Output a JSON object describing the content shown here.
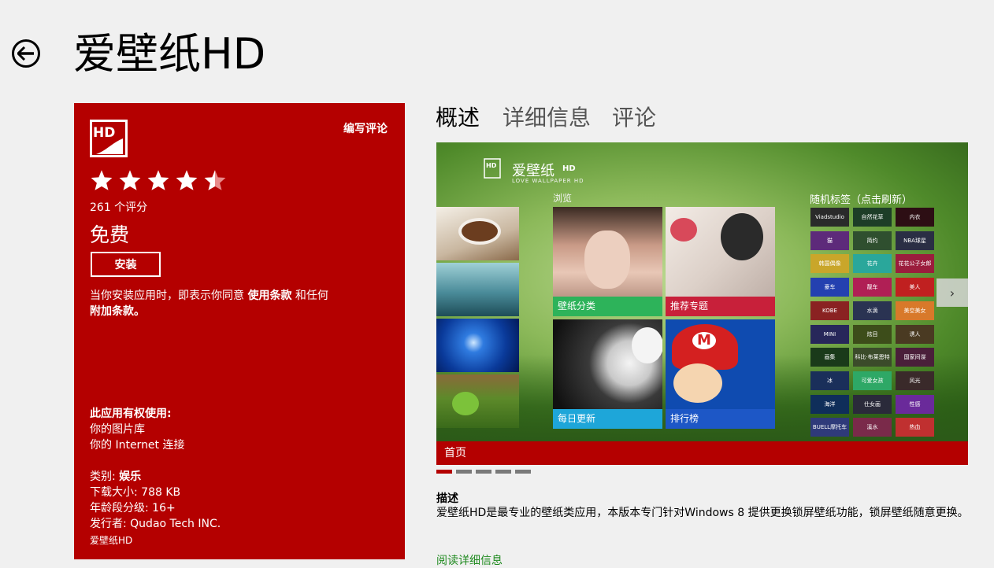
{
  "header": {
    "title": "爱壁纸HD",
    "back_icon": "back-arrow-icon"
  },
  "panel": {
    "background": "#b40000",
    "logo_text": "HD",
    "write_review": "编写评论",
    "rating": {
      "value": 4.5,
      "max": 5,
      "count_label": "261 个评分"
    },
    "price": "免费",
    "install_label": "安装",
    "terms": {
      "prefix": "当你安装应用时，即表示你同意",
      "terms_link": "使用条款",
      "middle": "和任何",
      "additional_link": "附加条款",
      "suffix": "。"
    },
    "permissions": {
      "title": "此应用有权使用:",
      "items": [
        "你的图片库",
        "你的 Internet 连接"
      ]
    },
    "meta": {
      "category_label": "类别:",
      "category_value": "娱乐",
      "size": "下载大小: 788 KB",
      "age": "年龄段分级: 16+",
      "publisher": "发行者: Qudao Tech INC.",
      "app_name": "爱壁纸HD"
    }
  },
  "tabs": [
    {
      "label": "概述",
      "active": true
    },
    {
      "label": "详细信息",
      "active": false
    },
    {
      "label": "评论",
      "active": false
    }
  ],
  "screenshot": {
    "logo_text": "爱壁纸",
    "logo_hd": "HD",
    "logo_sub": "LOVE WALLPAPER HD",
    "browse_label": "浏览",
    "tags_title": "随机标签（点击刷新）",
    "tiles": [
      {
        "label": "壁纸分类",
        "color": "#2db35a"
      },
      {
        "label": "推荐专题",
        "color": "#c8203a"
      },
      {
        "label": "每日更新",
        "color": "#1ea6d9"
      },
      {
        "label": "排行榜",
        "color": "#1d57c6"
      }
    ],
    "tags": [
      {
        "label": "Viadstudio",
        "color": "#2a2a2a"
      },
      {
        "label": "自然花草",
        "color": "#1d3d27"
      },
      {
        "label": "内衣",
        "color": "#2d0e14"
      },
      {
        "label": "猫",
        "color": "#5d2a7a"
      },
      {
        "label": "简约",
        "color": "#2f4f2f"
      },
      {
        "label": "NBA球星",
        "color": "#2a2e44"
      },
      {
        "label": "韩国偶像",
        "color": "#c9a62a"
      },
      {
        "label": "花卉",
        "color": "#2aa79b"
      },
      {
        "label": "花花公子女郎",
        "color": "#9b1d3d"
      },
      {
        "label": "豪车",
        "color": "#2440b0"
      },
      {
        "label": "靓车",
        "color": "#b01f55"
      },
      {
        "label": "美人",
        "color": "#c02020"
      },
      {
        "label": "KOBE",
        "color": "#8a2222"
      },
      {
        "label": "水滴",
        "color": "#2a3352"
      },
      {
        "label": "美空美女",
        "color": "#d8792a"
      },
      {
        "label": "MINI",
        "color": "#27275a"
      },
      {
        "label": "炫目",
        "color": "#3d4d1a"
      },
      {
        "label": "诱人",
        "color": "#4a3a22"
      },
      {
        "label": "画集",
        "color": "#1a3a1a"
      },
      {
        "label": "科比·布莱恩特",
        "color": "#3b4b2a"
      },
      {
        "label": "国家间谍",
        "color": "#4a1f3a"
      },
      {
        "label": "冰",
        "color": "#1a2f5a"
      },
      {
        "label": "可爱女孩",
        "color": "#2ea866"
      },
      {
        "label": "风光",
        "color": "#3a2a2a"
      },
      {
        "label": "海洋",
        "color": "#0f2e5a"
      },
      {
        "label": "仕女画",
        "color": "#2a2a3a"
      },
      {
        "label": "性感",
        "color": "#6a2a9a"
      },
      {
        "label": "BUELL摩托车",
        "color": "#2f3a7a"
      },
      {
        "label": "溪水",
        "color": "#7a2a4a"
      },
      {
        "label": "热血",
        "color": "#c03030"
      }
    ],
    "next_arrow": "chevron-right-icon",
    "bottom_label": "首页",
    "pages": 5,
    "current_page": 1
  },
  "description": {
    "title": "描述",
    "body": "爱壁纸HD是最专业的壁纸类应用，本版本专门针对Windows 8 提供更换锁屏壁纸功能，锁屏壁纸随意更换。",
    "read_more": "阅读详细信息"
  }
}
